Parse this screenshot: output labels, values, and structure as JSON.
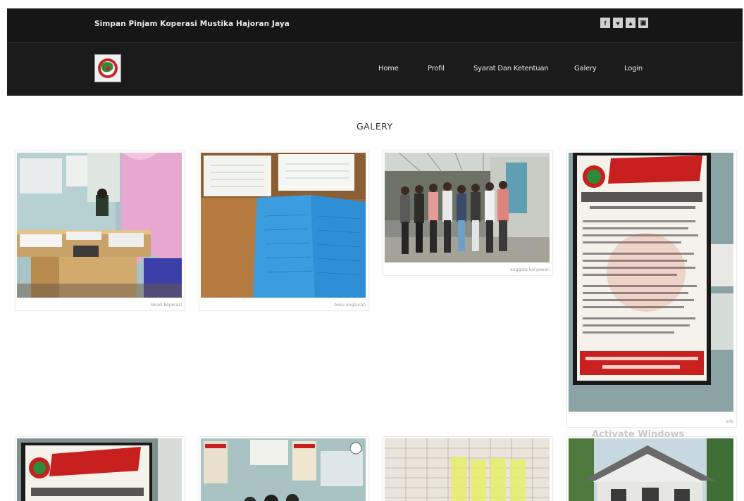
{
  "header": {
    "site_title": "Simpan Pinjam Koperasi Mustika Hajoran Jaya",
    "social_icons": [
      {
        "name": "facebook-icon",
        "glyph": "f"
      },
      {
        "name": "twitter-icon",
        "glyph": "♥"
      },
      {
        "name": "youtube-icon",
        "glyph": "▲"
      },
      {
        "name": "instagram-icon",
        "glyph": "▣"
      }
    ]
  },
  "nav": {
    "items": [
      "Home",
      "Profil",
      "Syarat Dan Ketentuan",
      "Galery",
      "Login"
    ]
  },
  "gallery": {
    "title": "GALERY",
    "captions": [
      "lokasi koperasi",
      "buku angsuran",
      "anggota karyawan",
      "info"
    ]
  },
  "watermark": "Activate Windows",
  "colors": {
    "topbar": "#161616",
    "navbar": "#1b1b1b",
    "poster_red": "#c8201f",
    "ledger_blue": "#3a9be0"
  }
}
